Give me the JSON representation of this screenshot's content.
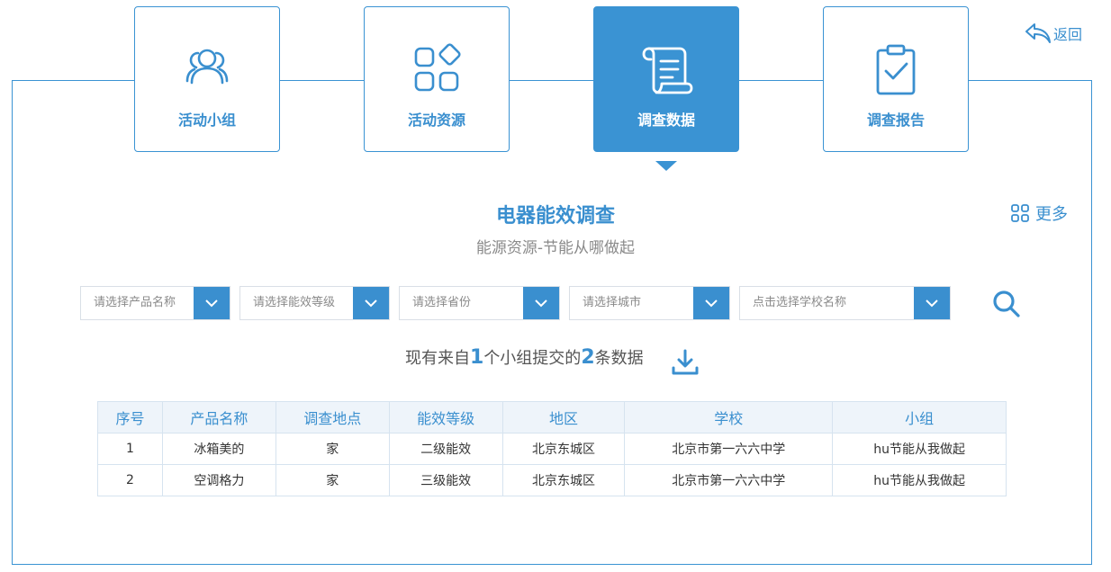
{
  "steps": [
    {
      "label": "活动小组",
      "icon": "users-icon",
      "active": false
    },
    {
      "label": "活动资源",
      "icon": "apps-grid-icon",
      "active": false
    },
    {
      "label": "调查数据",
      "icon": "scroll-document-icon",
      "active": true
    },
    {
      "label": "调查报告",
      "icon": "clipboard-check-icon",
      "active": false
    }
  ],
  "back_label": "返回",
  "more_label": "更多",
  "title": "电器能效调查",
  "subtitle": "能源资源-节能从哪做起",
  "filters": {
    "product": "请选择产品名称",
    "efficiency": "请选择能效等级",
    "province": "请选择省份",
    "city": "请选择城市",
    "school": "点击选择学校名称"
  },
  "summary": {
    "prefix": "现有来自",
    "groups": "1",
    "middle": "个小组提交的",
    "records": "2",
    "suffix": "条数据"
  },
  "table": {
    "headers": [
      "序号",
      "产品名称",
      "调查地点",
      "能效等级",
      "地区",
      "学校",
      "小组"
    ],
    "rows": [
      [
        "1",
        "冰箱美的",
        "家",
        "二级能效",
        "北京东城区",
        "北京市第一六六中学",
        "hu节能从我做起"
      ],
      [
        "2",
        "空调格力",
        "家",
        "三级能效",
        "北京东城区",
        "北京市第一六六中学",
        "hu节能从我做起"
      ]
    ]
  },
  "colors": {
    "accent": "#3a93d3",
    "header_bg": "#eef4fa",
    "border": "#d6e3ef"
  }
}
